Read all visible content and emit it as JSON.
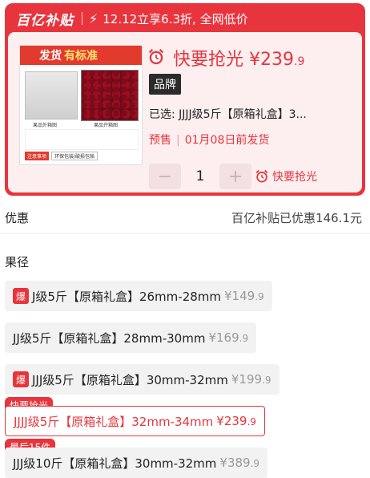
{
  "banner": {
    "logo": "百亿补贴",
    "promo": "12.12立享6.3折, 全网低价"
  },
  "product": {
    "image": {
      "header": "发货",
      "header_sub": "有标准",
      "caption_left": "果品外箱图",
      "caption_right": "果品开箱图",
      "tag_a": "注意事项",
      "tag_b": "环保包装/破损包赔"
    },
    "price_label": "快要抢光",
    "price_int": "¥239",
    "price_dec": ".9",
    "brand_badge": "品牌",
    "selected_text": "已选:  JJJJ级5斤【原箱礼盒】3...",
    "presale_label": "预售",
    "presale_date": "01月08日前发货",
    "quantity": "1",
    "minus": "−",
    "plus": "+",
    "grab_label": "快要抢光"
  },
  "discount": {
    "label": "优惠",
    "value": "百亿补贴已优惠146.1元"
  },
  "spec_section": {
    "title": "果径",
    "options": [
      {
        "badge": "爆",
        "label": "J级5斤【原箱礼盒】26mm-28mm",
        "price_int": "¥149",
        "price_dec": ".9"
      },
      {
        "badge": "",
        "label": "JJ级5斤【原箱礼盒】28mm-30mm",
        "price_int": "¥169",
        "price_dec": ".9"
      },
      {
        "badge": "爆",
        "label": "JJJ级5斤【原箱礼盒】30mm-32mm",
        "price_int": "¥199",
        "price_dec": ".9"
      },
      {
        "badge": "",
        "label": "JJJJ级5斤【原箱礼盒】32mm-34mm",
        "price_int": "¥239",
        "price_dec": ".9",
        "corner": "快要抢光"
      },
      {
        "badge": "",
        "label": "JJJ级10斤【原箱礼盒】30mm-32mm",
        "price_int": "¥389",
        "price_dec": ".9",
        "corner": "最后15件"
      }
    ]
  },
  "colors": {
    "accent": "#e8353d",
    "panel_bg": "#fdeff0",
    "option_bg": "#f2f2f2"
  }
}
